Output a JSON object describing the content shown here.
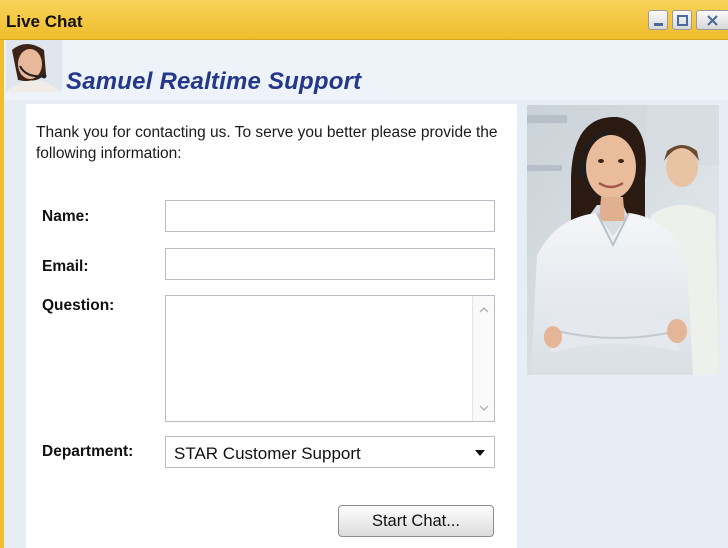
{
  "window": {
    "title": "Live Chat",
    "controls": {
      "minimize_icon": "minimize-icon",
      "maximize_icon": "maximize-icon",
      "close_icon": "close-icon"
    }
  },
  "brand": {
    "title": "Samuel Realtime Support",
    "avatar_icon": "support-agent-avatar"
  },
  "form": {
    "intro": "Thank you for contacting us. To serve you better please provide the following information:",
    "name_label": "Name:",
    "name_value": "",
    "email_label": "Email:",
    "email_value": "",
    "question_label": "Question:",
    "question_value": "",
    "department_label": "Department:",
    "department_value": "STAR Customer Support",
    "submit_label": "Start Chat..."
  },
  "photo": {
    "subject": "support-agent-photo"
  },
  "colors": {
    "titlebar": "#f3c540",
    "brand_text": "#23388a",
    "background": "#e7edf5",
    "panel": "#ffffff"
  }
}
